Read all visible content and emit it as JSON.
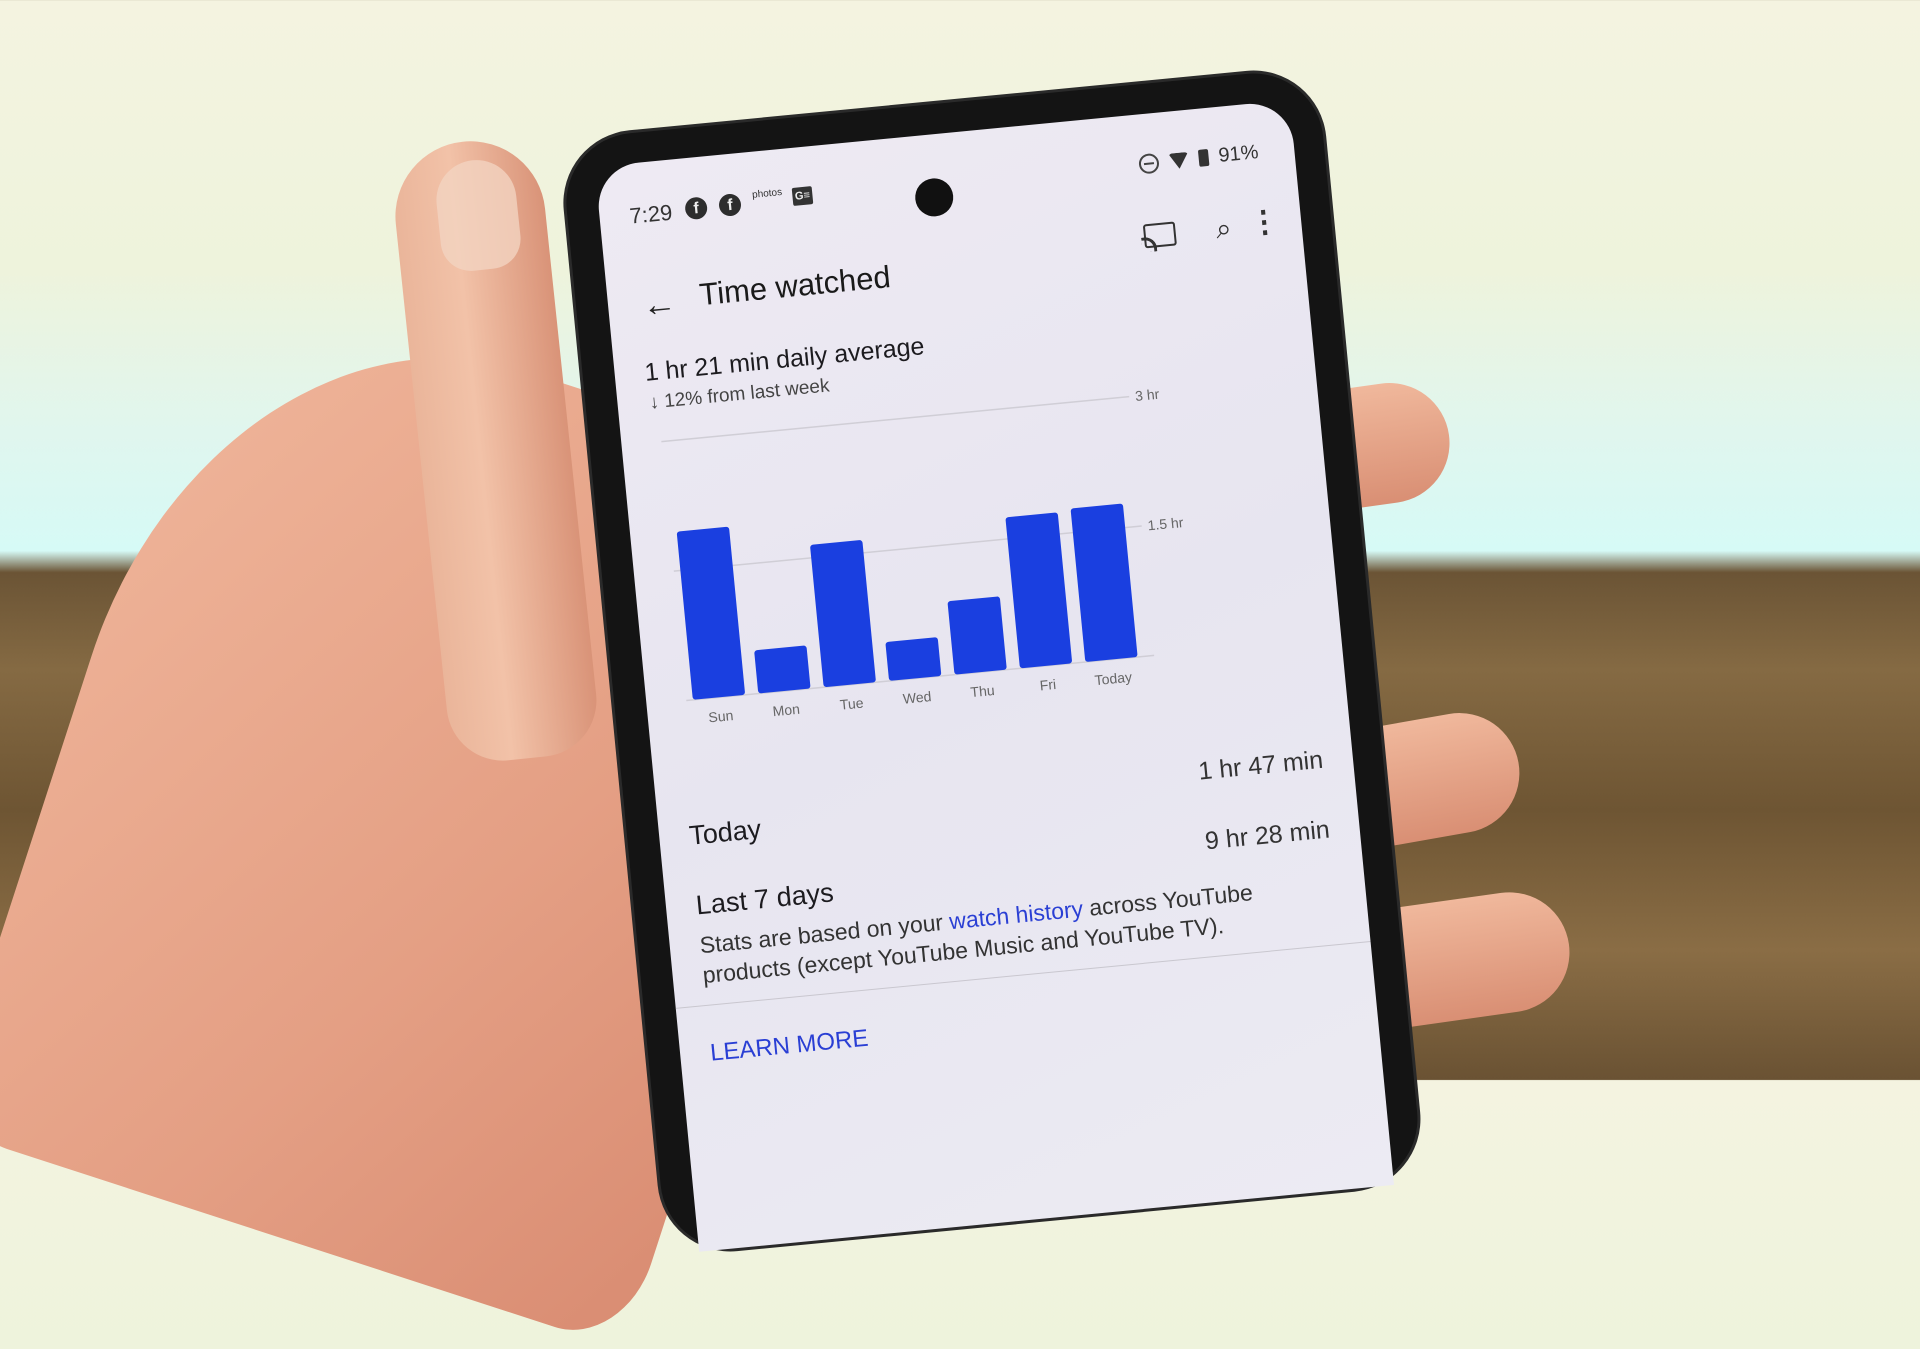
{
  "status_bar": {
    "time": "7:29",
    "notification_icons": [
      "facebook-icon",
      "facebook-icon",
      "amazon-photos-icon",
      "google-news-icon"
    ],
    "photos_label": "photos",
    "ge_label": "G≡",
    "battery": "91%"
  },
  "app_bar": {
    "title": "Time watched",
    "back_icon": "←",
    "search_icon": "⌕",
    "more_icon": "⋮"
  },
  "summary": {
    "daily_average": "1 hr 21 min daily average",
    "change_arrow": "↓",
    "change_text": "12% from last week"
  },
  "chart_data": {
    "type": "bar",
    "categories": [
      "Sun",
      "Mon",
      "Tue",
      "Wed",
      "Thu",
      "Fri",
      "Today"
    ],
    "values": [
      1.95,
      0.5,
      1.65,
      0.45,
      0.85,
      1.75,
      1.78
    ],
    "unit": "hr",
    "y_ticks": [
      {
        "value": 1.5,
        "label": "1.5 hr"
      },
      {
        "value": 3,
        "label": "3 hr"
      }
    ],
    "ylim": [
      0,
      3
    ],
    "title": "",
    "xlabel": "",
    "ylabel": "",
    "grid": true,
    "bar_color": "#1a3fe0"
  },
  "rows": [
    {
      "label": "Today",
      "value": "1 hr 47 min"
    },
    {
      "label": "Last 7 days",
      "value": "9 hr 28 min"
    }
  ],
  "info": {
    "text_before": "Stats are based on your ",
    "link": "watch history",
    "text_after": " across YouTube products (except YouTube Music and YouTube TV).",
    "learn_more": "LEARN MORE"
  }
}
